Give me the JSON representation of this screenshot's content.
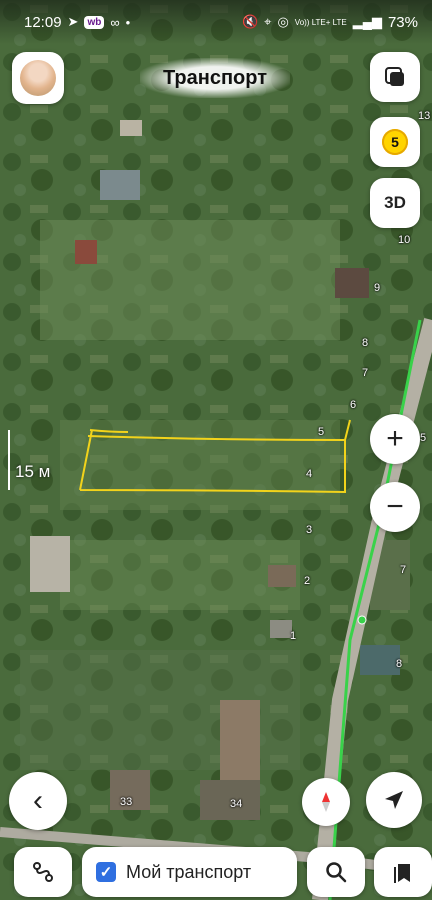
{
  "status": {
    "time": "12:09",
    "wb_badge": "wb",
    "lte_label": "Vo)) LTE+ LTE",
    "battery": "73%"
  },
  "header": {
    "title": "Транспорт"
  },
  "controls": {
    "layers_icon": "layers-icon",
    "traffic_score": "5",
    "three_d_label": "3D",
    "zoom_in": "+",
    "zoom_out": "−",
    "back": "‹",
    "my_location": "navigation-arrow-icon"
  },
  "scale": {
    "label": "15 м"
  },
  "plots": {
    "left_col": [
      "5",
      "4",
      "3",
      "2",
      "1"
    ],
    "right_col": [
      "13",
      "10",
      "9",
      "8",
      "7",
      "6",
      "5",
      "7",
      "8"
    ],
    "bottom": [
      "33",
      "34"
    ]
  },
  "bottom_bar": {
    "transport_label": "Мой транспорт",
    "checked": true
  },
  "colors": {
    "accent": "#2f6fe0",
    "route_green": "#39d24a",
    "sketch_yellow": "#f2d31b",
    "traffic_yellow": "#ffd400"
  }
}
